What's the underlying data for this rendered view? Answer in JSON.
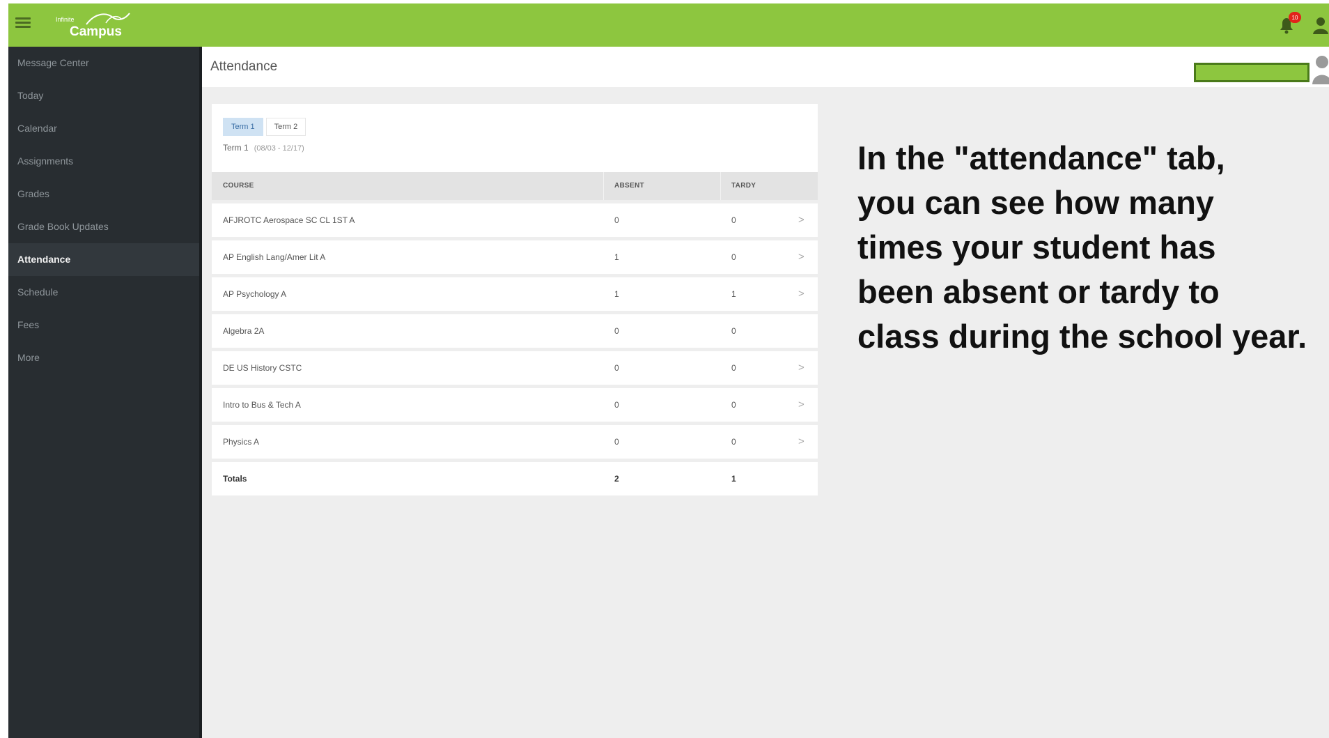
{
  "app": {
    "logo": {
      "small": "Infinite",
      "big": "Campus"
    },
    "notification_count": "10"
  },
  "sidebar": {
    "items": [
      {
        "label": "Message Center"
      },
      {
        "label": "Today"
      },
      {
        "label": "Calendar"
      },
      {
        "label": "Assignments"
      },
      {
        "label": "Grades"
      },
      {
        "label": "Grade Book Updates"
      },
      {
        "label": "Attendance",
        "active": true
      },
      {
        "label": "Schedule"
      },
      {
        "label": "Fees"
      },
      {
        "label": "More"
      }
    ]
  },
  "header": {
    "title": "Attendance"
  },
  "terms": {
    "tabs": [
      "Term 1",
      "Term 2"
    ],
    "selected": "Term 1",
    "range_label": "Term 1",
    "range_dates": "(08/03 - 12/17)"
  },
  "table": {
    "columns": [
      "COURSE",
      "ABSENT",
      "TARDY"
    ],
    "rows": [
      {
        "course": "AFJROTC Aerospace SC CL 1ST A",
        "absent": "0",
        "tardy": "0",
        "chevron": ">"
      },
      {
        "course": "AP English Lang/Amer Lit A",
        "absent": "1",
        "tardy": "0",
        "chevron": ">"
      },
      {
        "course": "AP Psychology A",
        "absent": "1",
        "tardy": "1",
        "chevron": ">"
      },
      {
        "course": "Algebra 2A",
        "absent": "0",
        "tardy": "0",
        "chevron": ""
      },
      {
        "course": "DE US History CSTC",
        "absent": "0",
        "tardy": "0",
        "chevron": ">"
      },
      {
        "course": "Intro to Bus & Tech A",
        "absent": "0",
        "tardy": "0",
        "chevron": ">"
      },
      {
        "course": "Physics A",
        "absent": "0",
        "tardy": "0",
        "chevron": ">"
      }
    ],
    "totals": {
      "label": "Totals",
      "absent": "2",
      "tardy": "1"
    }
  },
  "annotation": {
    "lines": [
      "In the \"attendance\" tab,",
      "you can see how many",
      "times your student has",
      "been absent or tardy to",
      "class during the school year."
    ]
  },
  "colors": {
    "topbar": "#8dc63f",
    "sidebar": "#282d31",
    "accent_tab": "#cfe2f3"
  }
}
